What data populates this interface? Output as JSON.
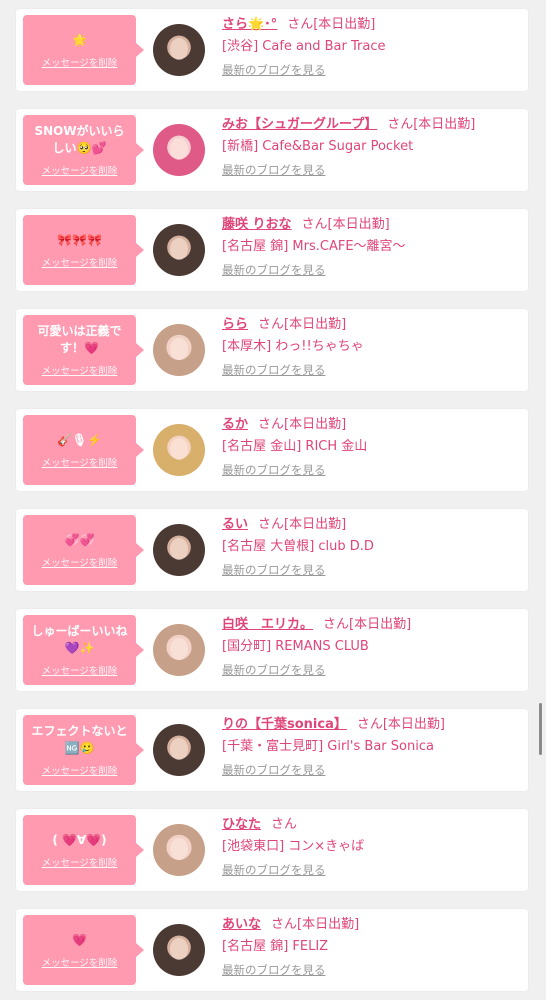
{
  "delete_label": "メッセージを削除",
  "blog_label": "最新のブログを見る",
  "colors": {
    "bubble": "#ff9ab1",
    "accent": "#e0457a",
    "muted": "#999999"
  },
  "entries": [
    {
      "message": "🌟",
      "name": "さら🌟･°",
      "suffix": "さん[本日出勤]",
      "shop": "[渋谷] Cafe and Bar Trace",
      "avatar": "dark"
    },
    {
      "message": "SNOWがいいらしい🥺💕",
      "name": "みお【シュガーグループ】",
      "suffix": "さん[本日出勤]",
      "shop": "[新橋] Cafe&Bar Sugar Pocket",
      "avatar": "pink"
    },
    {
      "message": "🎀🎀🎀",
      "name": "藤咲 りおな",
      "suffix": "さん[本日出勤]",
      "shop": "[名古屋 錦] Mrs.CAFE～離宮～",
      "avatar": "dark"
    },
    {
      "message": "可愛いは正義です！💗",
      "name": "らら",
      "suffix": "さん[本日出勤]",
      "shop": "[本厚木] わっ!!ちゃちゃ",
      "avatar": "light"
    },
    {
      "message": "🎸🎙⚡️",
      "name": "るか",
      "suffix": "さん[本日出勤]",
      "shop": "[名古屋 金山] RICH 金山",
      "avatar": "blonde"
    },
    {
      "message": "💞💞",
      "name": "るい",
      "suffix": "さん[本日出勤]",
      "shop": "[名古屋 大曽根] club D.D",
      "avatar": "dark"
    },
    {
      "message": "しゅーばーいいね💜✨",
      "name": "白咲　エリカ。",
      "suffix": "さん[本日出勤]",
      "shop": "[国分町] REMANS CLUB",
      "avatar": "light"
    },
    {
      "message": "エフェクトないと🆖🥲",
      "name": "りの【千葉sonica】",
      "suffix": "さん[本日出勤]",
      "shop": "[千葉・富士見町] Girl's Bar Sonica",
      "avatar": "dark"
    },
    {
      "message": "( 💗∀💗)",
      "name": "ひなた",
      "suffix": "さん",
      "shop": "[池袋東口] コン×きゃば",
      "avatar": "light"
    },
    {
      "message": "💗",
      "name": "あいな",
      "suffix": "さん[本日出勤]",
      "shop": "[名古屋 錦] FELIZ",
      "avatar": "dark"
    }
  ]
}
